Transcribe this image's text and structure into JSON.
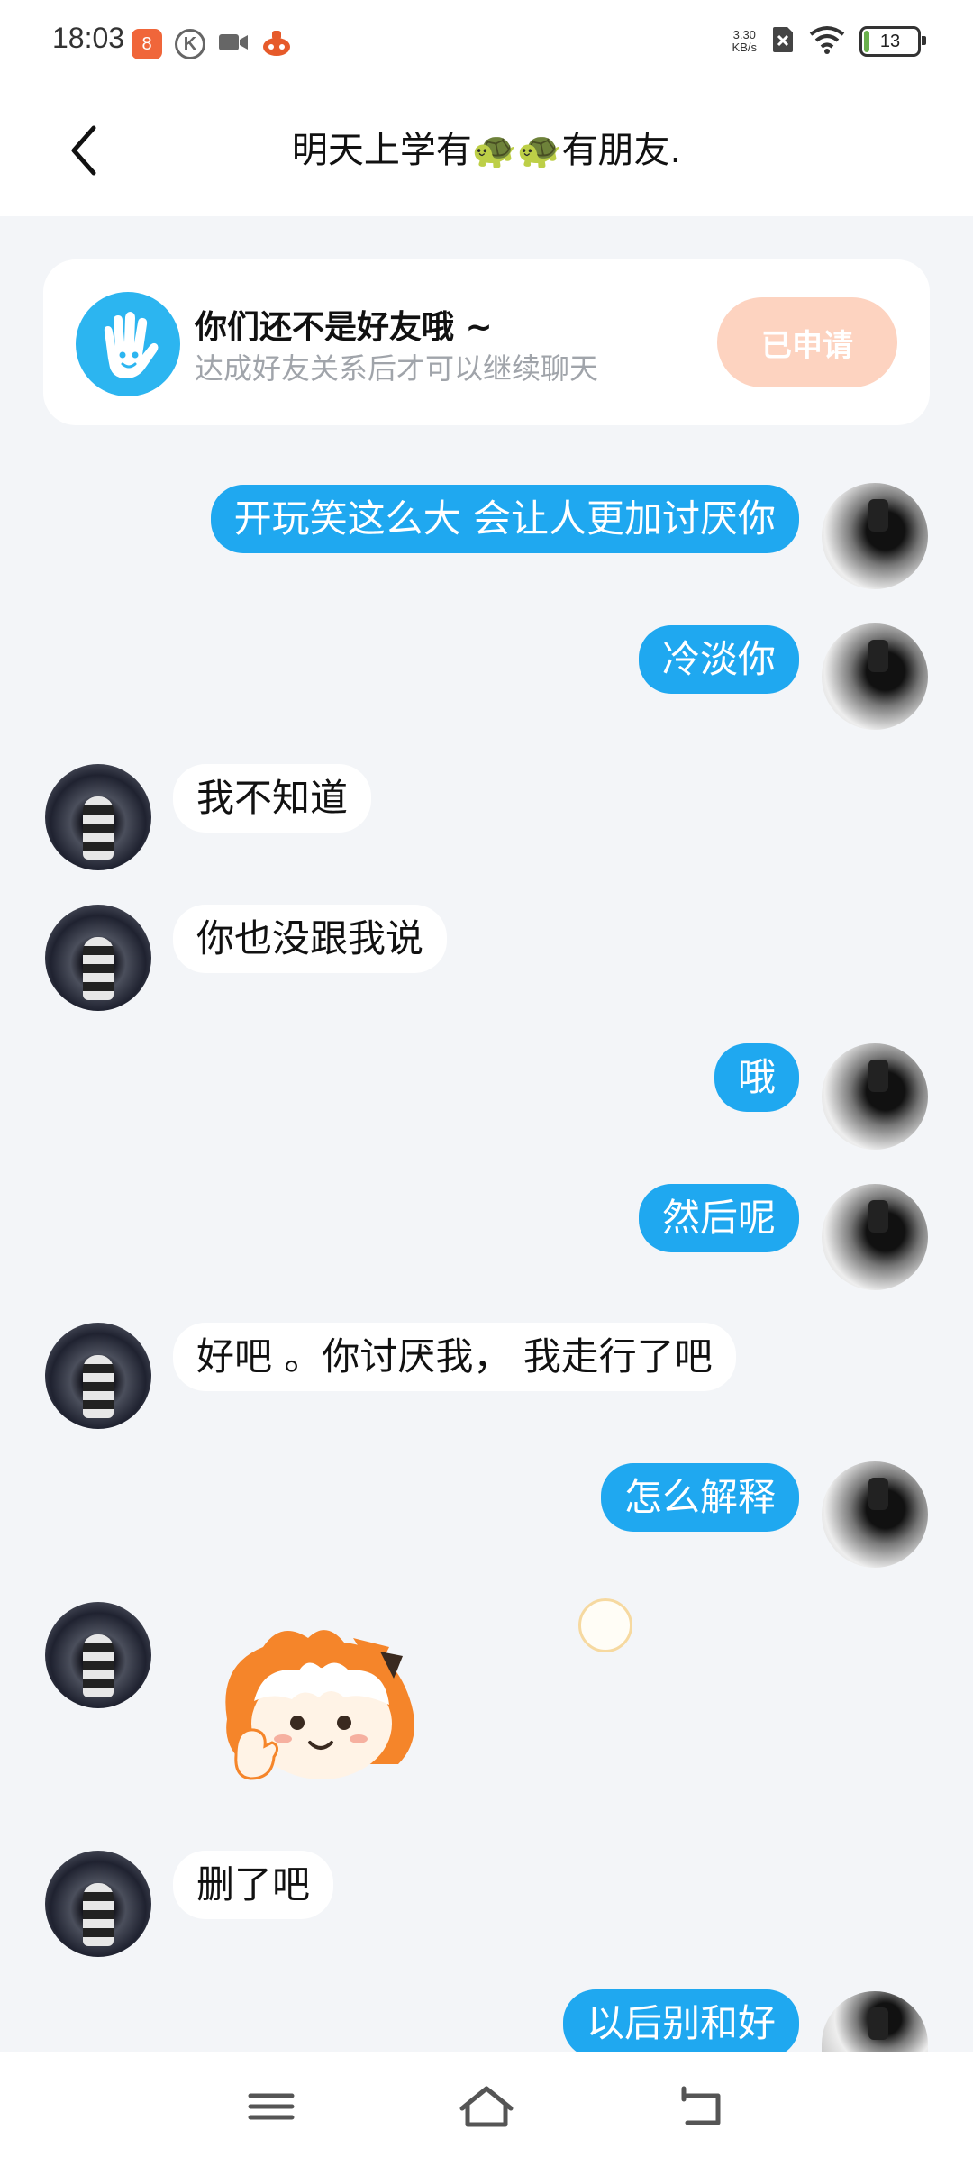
{
  "status": {
    "time": "18:03",
    "speed_value": "3.30",
    "speed_unit": "KB/s",
    "battery": "13"
  },
  "header": {
    "title_prefix": "明天上学有",
    "title_suffix": "有朋友.",
    "title_emoji": "🐢"
  },
  "friend_card": {
    "title": "你们还不是好友哦 ~",
    "subtitle": "达成好友关系后才可以继续聊天",
    "button": "已申请"
  },
  "messages": [
    {
      "side": "out",
      "text": "开玩笑这么大 会让人更加讨厌你"
    },
    {
      "side": "out",
      "text": "冷淡你"
    },
    {
      "side": "in",
      "text": "我不知道"
    },
    {
      "side": "in",
      "text": "你也没跟我说"
    },
    {
      "side": "out",
      "text": "哦"
    },
    {
      "side": "out",
      "text": "然后呢"
    },
    {
      "side": "in",
      "text": "好吧 。你讨厌我， 我走行了吧"
    },
    {
      "side": "out",
      "text": "怎么解释"
    },
    {
      "side": "in",
      "type": "sticker"
    },
    {
      "side": "in",
      "text": "删了吧"
    },
    {
      "side": "out",
      "text": "以后别和好"
    }
  ],
  "colors": {
    "accent": "#1FA8F0",
    "background": "#F3F5F8",
    "applied_button": "#FDD3C0"
  },
  "icons": {
    "back": "chevron-left-icon",
    "friend": "waving-hand-icon",
    "nav_menu": "menu-icon",
    "nav_home": "home-icon",
    "nav_back": "return-icon"
  }
}
